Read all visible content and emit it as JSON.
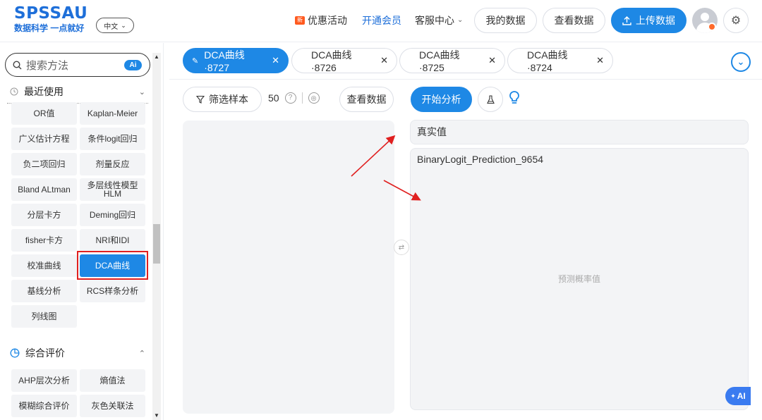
{
  "header": {
    "logo_main": "SPSSAU",
    "logo_sub": "数据科学 一点就好",
    "lang": "中文",
    "nav_promo": "优惠活动",
    "promo_icon_text": "新",
    "nav_member": "开通会员",
    "nav_service": "客服中心",
    "btn_mydata": "我的数据",
    "btn_viewdata": "查看数据",
    "btn_upload": "上传数据"
  },
  "sidebar": {
    "search_placeholder": "搜索方法",
    "ai_label": "Ai",
    "recent_title": "最近使用",
    "recent_items": [
      "OR值",
      "Kaplan-Meier",
      "广义估计方程",
      "条件logit回归",
      "负二项回归",
      "剂量反应",
      "Bland ALtman",
      "多层线性模型HLM",
      "分层卡方",
      "Deming回归",
      "fisher卡方",
      "NRI和IDI",
      "校准曲线",
      "DCA曲线",
      "基线分析",
      "RCS样条分析",
      "列线图"
    ],
    "active_item": "DCA曲线",
    "eval_title": "综合评价",
    "eval_items": [
      "AHP层次分析",
      "熵值法",
      "模糊综合评价",
      "灰色关联法"
    ]
  },
  "tabs": [
    {
      "label": "DCA曲线·8727",
      "active": true
    },
    {
      "label": "DCA曲线·8726",
      "active": false
    },
    {
      "label": "DCA曲线·8725",
      "active": false
    },
    {
      "label": "DCA曲线·8724",
      "active": false
    }
  ],
  "toolbar": {
    "filter_label": "筛选样本",
    "count": "50",
    "viewdata_label": "查看数据",
    "start_label": "开始分析"
  },
  "analysis": {
    "true_value_label": "真实值",
    "pred_variable": "BinaryLogit_Prediction_9654",
    "pred_placeholder": "预测概率值",
    "ai_float_label": "AI"
  },
  "colors": {
    "accent": "#1e88e5",
    "highlight": "#e02020"
  }
}
